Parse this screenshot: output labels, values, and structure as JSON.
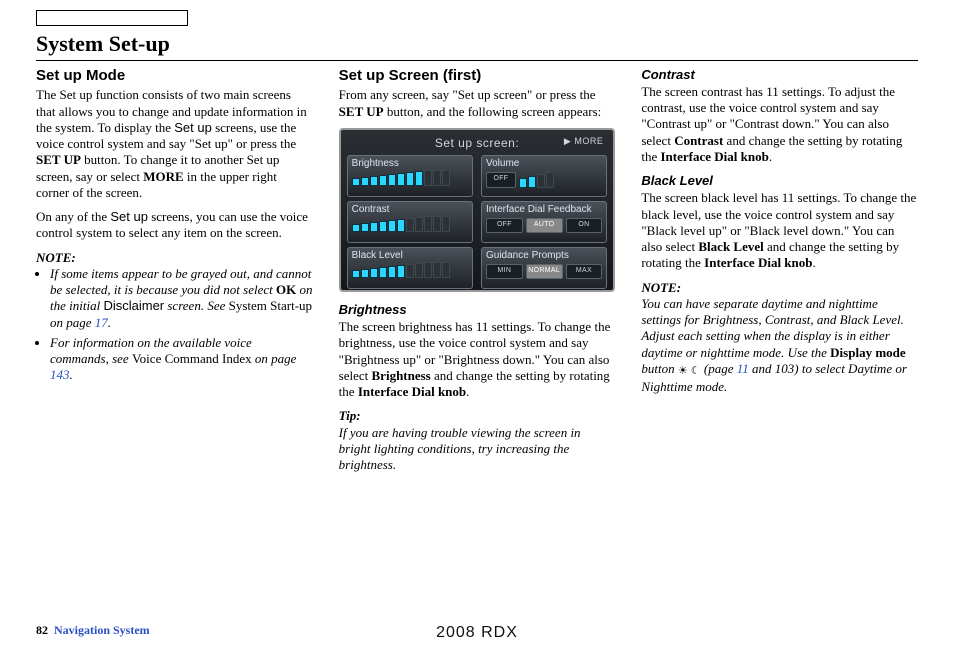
{
  "title": "System Set-up",
  "footer": {
    "page_number": "82",
    "section": "Navigation System",
    "model": "2008 RDX"
  },
  "col1": {
    "heading": "Set up Mode",
    "p1a": "The Set up function consists of two main screens that allows you to change and update information in the system. To display the ",
    "p1b": "Set up",
    "p1c": " screens, use the voice control system and say \"Set up\" or press the ",
    "p1d": "SET UP",
    "p1e": " button. To change it to another Set up screen, say or select ",
    "p1f": "MORE",
    "p1g": " in the upper right corner of the screen.",
    "p2a": "On any of the ",
    "p2b": "Set up",
    "p2c": " screens, you can use the voice control system to select any item on the screen.",
    "note_label": "NOTE:",
    "note1a": "If some items appear to be grayed out, and cannot be selected, it is because you did not select ",
    "note1b": "OK",
    "note1c": " on the initial ",
    "note1d": "Disclaimer",
    "note1e": " screen. See ",
    "note1f": "System Start-up",
    "note1g": " on page ",
    "note1h": "17",
    "note1i": ".",
    "note2a": "For information on the available voice commands, see ",
    "note2b": "Voice Command Index",
    "note2c": " on page ",
    "note2d": "143",
    "note2e": "."
  },
  "col2": {
    "heading": "Set up Screen (first)",
    "p1a": "From any screen, say \"Set up screen\" or press the ",
    "p1b": "SET UP",
    "p1c": " button, and the following screen appears:",
    "screen": {
      "title": "Set up screen:",
      "more": "▶ MORE",
      "cells": {
        "brightness": "Brightness",
        "volume": "Volume",
        "contrast": "Contrast",
        "interface_dial": "Interface Dial Feedback",
        "black_level": "Black Level",
        "guidance": "Guidance Prompts"
      },
      "pills": {
        "off": "OFF",
        "on": "ON",
        "auto": "AUTO",
        "min": "MIN",
        "normal": "NORMAL",
        "max": "MAX"
      }
    },
    "brightness_heading": "Brightness",
    "brightness_a": "The screen brightness has 11 settings. To change the brightness, use the voice control system and say \"Brightness up\" or \"Brightness down.\" You can also select ",
    "brightness_b": "Brightness",
    "brightness_c": " and change the setting by rotating the ",
    "brightness_d": "Interface Dial knob",
    "brightness_e": ".",
    "tip_label": "Tip:",
    "tip_body": "If you are having trouble viewing the screen in bright lighting conditions, try increasing the brightness."
  },
  "col3": {
    "contrast_heading": "Contrast",
    "contrast_a": "The screen contrast has 11 settings. To adjust the contrast, use the voice control system and say \"Contrast up\" or \"Contrast down.\" You can also select ",
    "contrast_b": "Contrast",
    "contrast_c": " and change the setting by rotating the ",
    "contrast_d": "Interface Dial knob",
    "contrast_e": ".",
    "black_heading": "Black Level",
    "black_a": "The screen black level has 11 settings. To change the black level, use the voice control system and say \"Black level up\" or \"Black level down.\" You can also select ",
    "black_b": "Black Level",
    "black_c": " and change the setting by rotating the ",
    "black_d": "Interface Dial knob",
    "black_e": ".",
    "note_label": "NOTE:",
    "note_a": "You can have separate daytime and nighttime settings for Brightness, Contrast, and Black Level. Adjust each setting when the display is in either daytime or nighttime mode. Use the ",
    "note_b": "Display mode",
    "note_c": " button ",
    "note_icon": "☀ ☾",
    "note_d": " (page ",
    "note_e": "11",
    "note_f": " and 103) to select Daytime or Nighttime mode."
  }
}
